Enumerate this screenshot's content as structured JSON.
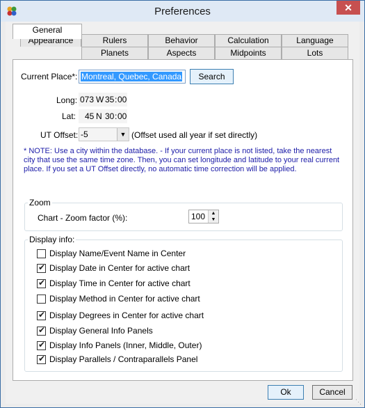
{
  "window": {
    "title": "Preferences",
    "close_label": "✕"
  },
  "tabs_row1": [
    "Appearance",
    "Rulers",
    "Behavior",
    "Calculation",
    "Language"
  ],
  "tabs_row2": [
    "General",
    "Planets",
    "Aspects",
    "Midpoints",
    "Lots"
  ],
  "place": {
    "label": "Current Place*:",
    "value": "Montreal, Quebec, Canada",
    "search_label": "Search"
  },
  "coords": {
    "long_label": "Long:",
    "long_deg": "073",
    "long_dir": "W",
    "long_min": "35",
    "long_sep": ":",
    "long_sec": "00",
    "lat_label": "Lat:",
    "lat_deg": "45",
    "lat_dir": "N",
    "lat_min": "30",
    "lat_sep": ":",
    "lat_sec": "00"
  },
  "ut": {
    "label": "UT Offset:",
    "value": "-5",
    "note": "(Offset used all year if set directly)"
  },
  "note": "* NOTE:  Use a city within the database. - If your current place is not listed, take the nearest city that use the same time zone. Then, you can set longitude and latitude to your real current place. If you set a UT Offset directly, no automatic time correction will be applied.",
  "zoom": {
    "title": "Zoom",
    "label": "Chart - Zoom factor (%):",
    "value": "100"
  },
  "display": {
    "title": "Display info:",
    "items": [
      {
        "label": "Display Name/Event Name in Center",
        "checked": false
      },
      {
        "label": "Display Date in Center for active chart",
        "checked": true
      },
      {
        "label": "Display Time in Center for active chart",
        "checked": true
      },
      {
        "label": "Display Method in Center for active chart",
        "checked": false
      },
      {
        "label": "Display Degrees in Center for active chart",
        "checked": true
      },
      {
        "label": "Display General Info Panels",
        "checked": true
      },
      {
        "label": "Display Info Panels (Inner, Middle, Outer)",
        "checked": true
      },
      {
        "label": "Display Parallels / Contraparallels Panel",
        "checked": true
      }
    ]
  },
  "buttons": {
    "ok": "Ok",
    "cancel": "Cancel"
  }
}
